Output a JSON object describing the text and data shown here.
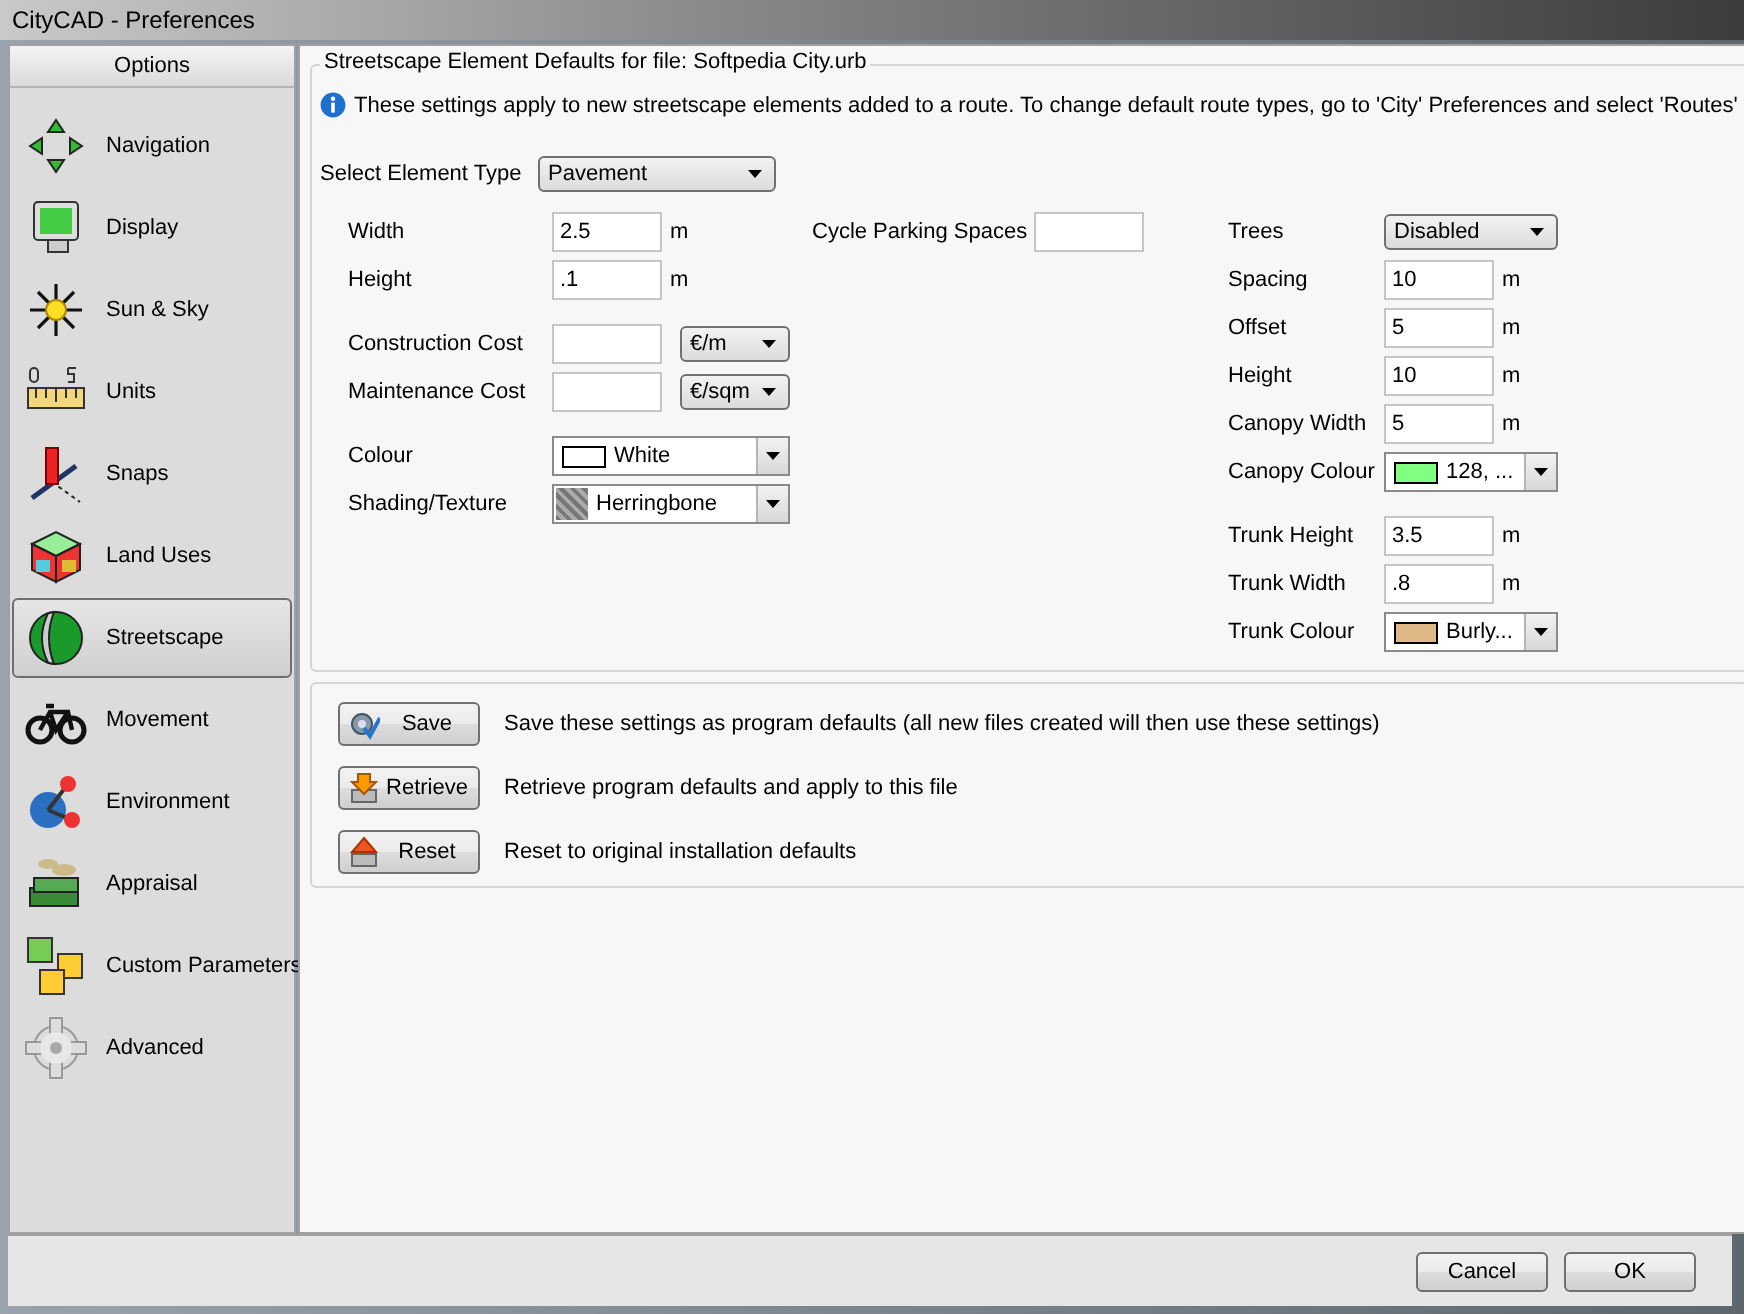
{
  "window": {
    "title": "CityCAD - Preferences"
  },
  "sidebar": {
    "header": "Options",
    "items": [
      {
        "label": "Navigation",
        "selected": false
      },
      {
        "label": "Display",
        "selected": false
      },
      {
        "label": "Sun & Sky",
        "selected": false
      },
      {
        "label": "Units",
        "selected": false
      },
      {
        "label": "Snaps",
        "selected": false
      },
      {
        "label": "Land Uses",
        "selected": false
      },
      {
        "label": "Streetscape",
        "selected": true
      },
      {
        "label": "Movement",
        "selected": false
      },
      {
        "label": "Environment",
        "selected": false
      },
      {
        "label": "Appraisal",
        "selected": false
      },
      {
        "label": "Custom Parameters",
        "selected": false
      },
      {
        "label": "Advanced",
        "selected": false
      }
    ]
  },
  "panel": {
    "title": "Streetscape Element Defaults for file: Softpedia City.urb",
    "info": "These settings apply to new streetscape elements added to a route. To change default route types, go to 'City' Preferences and select 'Routes'",
    "element_type": {
      "label": "Select Element Type",
      "value": "Pavement"
    },
    "left_groups": [
      [
        {
          "kind": "input",
          "label": "Width",
          "value": "2.5",
          "unit": "m"
        },
        {
          "kind": "input",
          "label": "Height",
          "value": ".1",
          "unit": "m"
        }
      ],
      [
        {
          "kind": "input_select",
          "label": "Construction Cost",
          "option": "€/m"
        },
        {
          "kind": "input_select",
          "label": "Maintenance Cost",
          "option": "€/sqm"
        }
      ],
      [
        {
          "kind": "colour",
          "label": "Colour",
          "value": "White",
          "color": "#ffffff"
        },
        {
          "kind": "texture",
          "label": "Shading/Texture",
          "value": "Herringbone"
        }
      ]
    ],
    "middle_groups": [
      [
        {
          "kind": "input",
          "label": "Cycle Parking Spaces"
        }
      ]
    ],
    "right_groups": [
      [
        {
          "kind": "select",
          "label": "Trees",
          "value": "Disabled"
        },
        {
          "kind": "input",
          "label": "Spacing",
          "value": "10",
          "unit": "m"
        },
        {
          "kind": "input",
          "label": "Offset",
          "value": "5",
          "unit": "m"
        },
        {
          "kind": "input",
          "label": "Height",
          "value": "10",
          "unit": "m"
        },
        {
          "kind": "input",
          "label": "Canopy Width",
          "value": "5",
          "unit": "m"
        },
        {
          "kind": "colour",
          "label": "Canopy Colour",
          "value": "128, ...",
          "color": "#80ff80"
        }
      ],
      [
        {
          "kind": "input",
          "label": "Trunk Height",
          "value": "3.5",
          "unit": "m"
        },
        {
          "kind": "input",
          "label": "Trunk Width",
          "value": ".8",
          "unit": "m"
        },
        {
          "kind": "colour",
          "label": "Trunk Colour",
          "value": "Burly...",
          "color": "#deb887"
        }
      ]
    ]
  },
  "actions": [
    {
      "label": "Save",
      "description": "Save these settings as program defaults (all new files created will then use these settings)"
    },
    {
      "label": "Retrieve",
      "description": "Retrieve program defaults and apply to this file"
    },
    {
      "label": "Reset",
      "description": "Reset to original installation defaults"
    }
  ],
  "buttons": [
    {
      "label": "Cancel"
    },
    {
      "label": "OK"
    }
  ]
}
